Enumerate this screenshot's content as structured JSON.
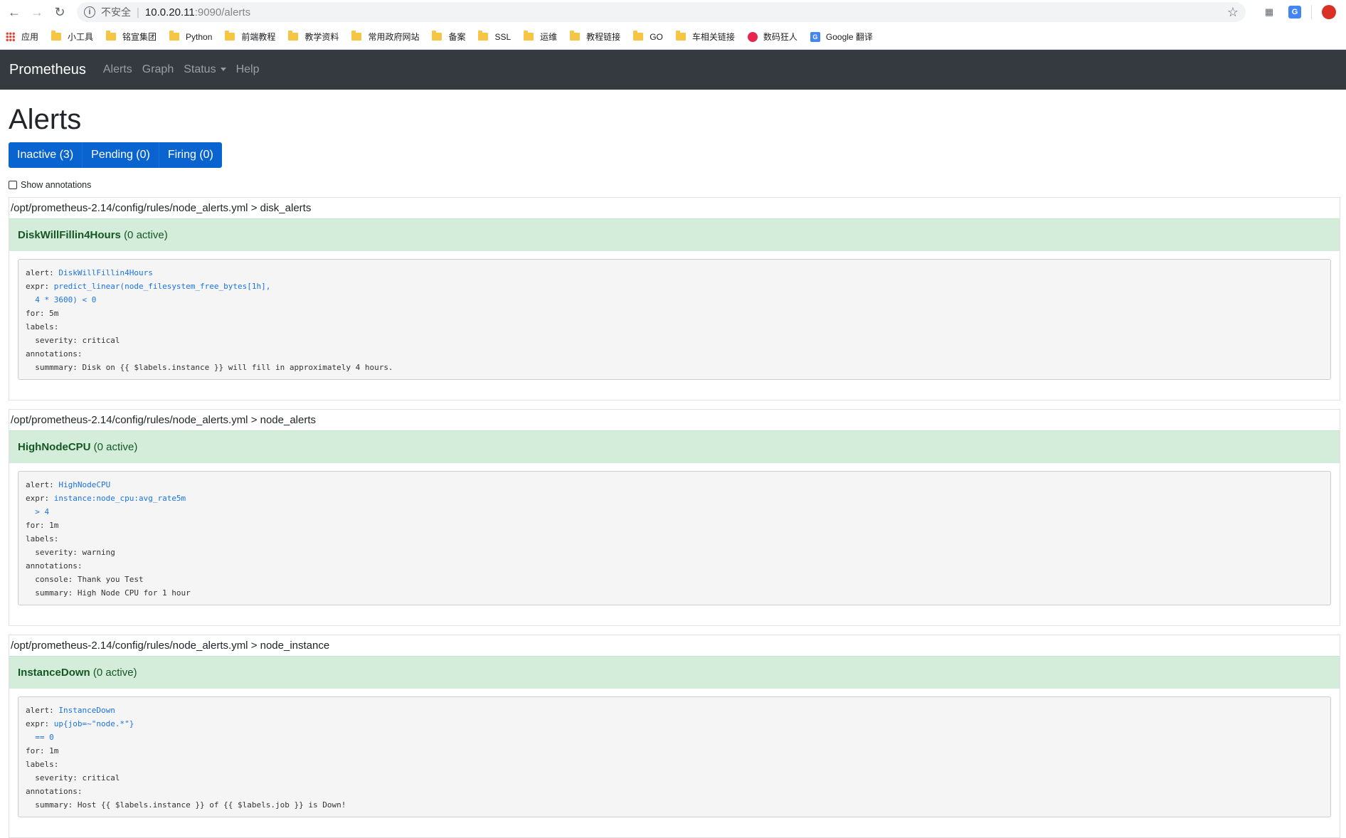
{
  "browser": {
    "insecure_label": "不安全",
    "url_host": "10.0.20.11",
    "url_path": ":9090/alerts",
    "bookmarks": [
      {
        "label": "应用",
        "icon": "apps-grid-icon"
      },
      {
        "label": "小工具",
        "icon": "folder-icon"
      },
      {
        "label": "铭宣集团",
        "icon": "folder-icon"
      },
      {
        "label": "Python",
        "icon": "folder-icon"
      },
      {
        "label": "前端教程",
        "icon": "folder-icon"
      },
      {
        "label": "教学资料",
        "icon": "folder-icon"
      },
      {
        "label": "常用政府网站",
        "icon": "folder-icon"
      },
      {
        "label": "备案",
        "icon": "folder-icon"
      },
      {
        "label": "SSL",
        "icon": "folder-icon"
      },
      {
        "label": "运维",
        "icon": "folder-icon"
      },
      {
        "label": "教程链接",
        "icon": "folder-icon"
      },
      {
        "label": "GO",
        "icon": "folder-icon"
      },
      {
        "label": "车相关链接",
        "icon": "folder-icon"
      },
      {
        "label": "数码狂人",
        "icon": "red-dot-icon"
      },
      {
        "label": "Google 翻译",
        "icon": "google-translate-icon"
      }
    ]
  },
  "navbar": {
    "brand": "Prometheus",
    "links": [
      "Alerts",
      "Graph",
      "Status",
      "Help"
    ]
  },
  "page": {
    "title": "Alerts",
    "filters": [
      "Inactive (3)",
      "Pending (0)",
      "Firing (0)"
    ],
    "show_annotations": "Show annotations"
  },
  "groups": [
    {
      "file": "/opt/prometheus-2.14/config/rules/node_alerts.yml",
      "sep": ">",
      "name": "disk_alerts",
      "rule_name": "DiskWillFillin4Hours",
      "rule_status": "(0 active)",
      "yaml": {
        "alert_key": "alert: ",
        "alert_val": "DiskWillFillin4Hours",
        "expr_key": "expr: ",
        "expr_val1": "predict_linear(node_filesystem_free_bytes[1h],",
        "expr_val2": "  4 * 3600) < 0",
        "for_line": "for: 5m",
        "labels_line": "labels:",
        "label1": "  severity: critical",
        "annotations_line": "annotations:",
        "ann1": "  summmary: Disk on {{ $labels.instance }} will fill in approximately 4 hours.",
        "ann2": ""
      }
    },
    {
      "file": "/opt/prometheus-2.14/config/rules/node_alerts.yml",
      "sep": ">",
      "name": "node_alerts",
      "rule_name": "HighNodeCPU",
      "rule_status": "(0 active)",
      "yaml": {
        "alert_key": "alert: ",
        "alert_val": "HighNodeCPU",
        "expr_key": "expr: ",
        "expr_val1": "instance:node_cpu:avg_rate5m",
        "expr_val2": "  > 4",
        "for_line": "for: 1m",
        "labels_line": "labels:",
        "label1": "  severity: warning",
        "annotations_line": "annotations:",
        "ann1": "  console: Thank you Test",
        "ann2": "  summary: High Node CPU for 1 hour"
      }
    },
    {
      "file": "/opt/prometheus-2.14/config/rules/node_alerts.yml",
      "sep": ">",
      "name": "node_instance",
      "rule_name": "InstanceDown",
      "rule_status": "(0 active)",
      "yaml": {
        "alert_key": "alert: ",
        "alert_val": "InstanceDown",
        "expr_key": "expr: ",
        "expr_val1": "up{job=~\"node.*\"}",
        "expr_val2": "  == 0",
        "for_line": "for: 1m",
        "labels_line": "labels:",
        "label1": "  severity: critical",
        "annotations_line": "annotations:",
        "ann1": "  summary: Host {{ $labels.instance }} of {{ $labels.job }} is Down!",
        "ann2": ""
      }
    }
  ]
}
